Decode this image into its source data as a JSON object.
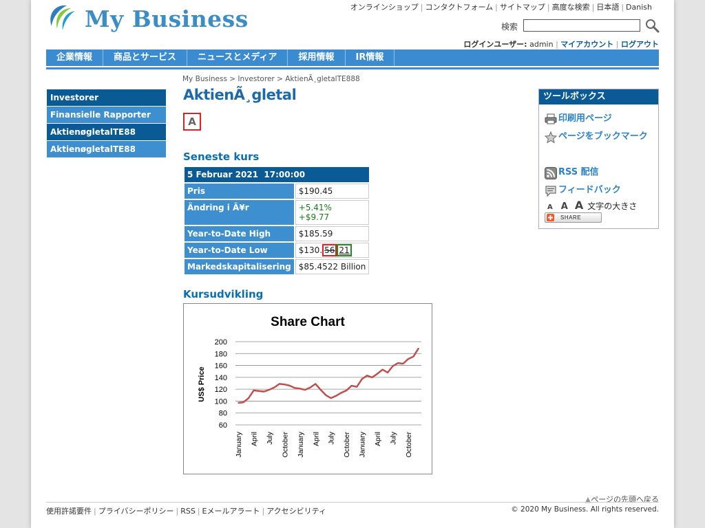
{
  "site": {
    "logo_text": "My Business"
  },
  "utility_nav": [
    {
      "label": "オンラインショップ"
    },
    {
      "label": "コンタクトフォーム"
    },
    {
      "label": "サイトマップ"
    },
    {
      "label": "高度な検索"
    },
    {
      "label": "日本語"
    },
    {
      "label": "Danish"
    }
  ],
  "search": {
    "label": "検索",
    "value": "",
    "placeholder": ""
  },
  "login": {
    "prefix": "ログインユーザー:",
    "user": "admin",
    "my_account": "マイアカウント",
    "logout": "ログアウト"
  },
  "main_nav": [
    {
      "label": "企業情報"
    },
    {
      "label": "商品とサービス"
    },
    {
      "label": "ニュースとメディア"
    },
    {
      "label": "採用情報"
    },
    {
      "label": "IR情報"
    }
  ],
  "breadcrumb": {
    "items": [
      "My Business",
      "Investorer",
      "AktienÃ¸gletalTE888"
    ],
    "separator": ">"
  },
  "sidebar": {
    "items": [
      {
        "label": "Investorer",
        "style": "dark"
      },
      {
        "label": "Finansielle Rapporter",
        "style": "light"
      },
      {
        "label": "AktienøgletalTE88",
        "style": "dark"
      },
      {
        "label": "AktienøgletalTE88",
        "style": "light"
      }
    ]
  },
  "main": {
    "title": "AktienÃ¸gletal",
    "font_icon_letter": "A",
    "quote_heading": "Seneste kurs",
    "chart_heading": "Kursudvikling"
  },
  "quote": {
    "datetime": "5 Februar 2021  17:00:00",
    "rows": {
      "price": {
        "label": "Pris",
        "value": "$190.45"
      },
      "change": {
        "label": "Ändring i Ã¥r",
        "pct": "+5.41%",
        "abs": "+$9.77"
      },
      "ytd_high": {
        "label": "Year-to-Date High",
        "value": "$185.59"
      },
      "ytd_low": {
        "label": "Year-to-Date Low",
        "prefix": "$130.",
        "struck": "56",
        "corrected": "21"
      },
      "market_cap": {
        "label": "Markedskapitalisering",
        "value": "$85.4522 Billion"
      }
    }
  },
  "toolbox": {
    "title": "ツールボックス",
    "print": "印刷用ページ",
    "bookmark": "ページをブックマーク",
    "rss": "RSS 配信",
    "feedback": "フィードバック",
    "font_a1": "A",
    "font_a2": "A",
    "font_a3": "A",
    "font_size_label": "文字の大きさ",
    "share": "SHARE"
  },
  "footer": {
    "back_to_top": "ページの先頭へ戻る",
    "links": [
      "使用許諾要件",
      "プライバシーポリシー",
      "RSS",
      "Eメールアラート",
      "アクセシビリティ"
    ],
    "copyright": "© 2020 My Business. All rights reserved."
  },
  "colors": {
    "nav_blue": "#3a8bd0",
    "dark_blue": "#0a5a96",
    "line_red": "#c0504d",
    "positive_green": "#1a7a1a"
  },
  "chart_data": {
    "type": "line",
    "title": "Share Chart",
    "ylabel": "US$ Price",
    "xlabel": "",
    "ylim": [
      60,
      200
    ],
    "yticks": [
      60,
      80,
      100,
      120,
      140,
      160,
      180,
      200
    ],
    "grid": true,
    "x_tick_labels": [
      "January",
      "April",
      "July",
      "October",
      "January",
      "April",
      "July",
      "October",
      "January",
      "April",
      "July",
      "October"
    ],
    "series": [
      {
        "values": [
          97,
          98,
          105,
          118,
          117,
          116,
          119,
          123,
          129,
          128,
          126,
          122,
          121,
          119,
          123,
          129,
          119,
          110,
          105,
          109,
          114,
          118,
          126,
          124,
          137,
          143,
          140,
          146,
          153,
          148,
          159,
          164,
          163,
          171,
          175,
          189
        ]
      }
    ]
  }
}
